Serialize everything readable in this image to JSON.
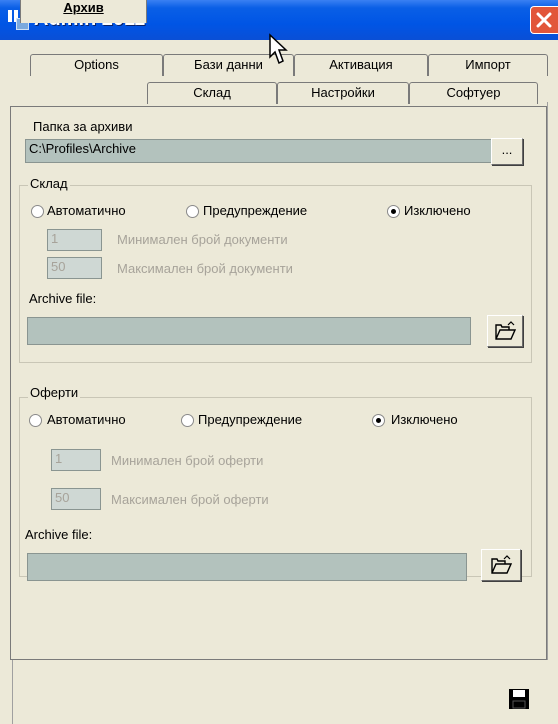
{
  "window": {
    "title": "Admin 2011"
  },
  "tabs_back": [
    {
      "label": "Options"
    },
    {
      "label": "Бази данни"
    },
    {
      "label": "Активация"
    },
    {
      "label": "Импорт"
    }
  ],
  "tabs_front": [
    {
      "label": "Архив",
      "active": true
    },
    {
      "label": "Склад"
    },
    {
      "label": "Настройки"
    },
    {
      "label": "Софтуер"
    }
  ],
  "archive_folder": {
    "label": "Папка за архиви",
    "value": "C:\\Profiles\\Archive",
    "browse_label": "..."
  },
  "sklad": {
    "title": "Склад",
    "radios": [
      {
        "label": "Автоматично",
        "checked": false
      },
      {
        "label": "Предупреждение",
        "checked": false
      },
      {
        "label": "Изключено",
        "checked": true
      }
    ],
    "min_value": "1",
    "min_label": "Минимален брой документи",
    "max_value": "50",
    "max_label": "Максимален брой документи",
    "file_label": "Archive file:",
    "file_value": ""
  },
  "oferti": {
    "title": "Оферти",
    "radios": [
      {
        "label": "Автоматично",
        "checked": false
      },
      {
        "label": "Предупреждение",
        "checked": false
      },
      {
        "label": "Изключено",
        "checked": true
      }
    ],
    "min_value": "1",
    "min_label": "Минимален брой оферти",
    "max_value": "50",
    "max_label": "Максимален брой оферти",
    "file_label": "Archive file:",
    "file_value": ""
  },
  "icons": {
    "open_folder": "open-folder-icon",
    "save": "floppy-disk-icon",
    "close": "close-icon"
  }
}
